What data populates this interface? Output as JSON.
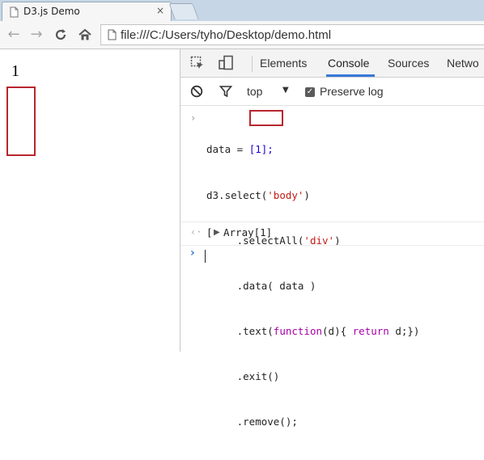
{
  "browser": {
    "tab_title": "D3.js Demo",
    "tab_close": "×",
    "url": "file:///C:/Users/tyho/Desktop/demo.html"
  },
  "page": {
    "text": "1"
  },
  "devtools": {
    "tabs": [
      "Elements",
      "Console",
      "Sources",
      "Netwo"
    ],
    "active_tab": "Console",
    "context": "top",
    "preserve_log_label": "Preserve log",
    "preserve_log_checked": true
  },
  "console": {
    "input_lines": [
      {
        "plain_pre": "data = ",
        "highlight": "[1];"
      },
      {
        "plain": "d3.select(",
        "str": "'body'",
        "plain_post": ")"
      },
      {
        "plain": "     .selectAll(",
        "str": "'div'",
        "plain_post": ")"
      },
      {
        "plain": "     .data( data )"
      },
      {
        "plain": "     .text(",
        "kw": "function",
        "plain_mid": "(d){ ",
        "kw2": "return",
        "plain_post": " d;})"
      },
      {
        "plain": "     .exit()"
      },
      {
        "plain": "     .remove();"
      }
    ],
    "result": "Array[1]",
    "result_prefix": "["
  },
  "colors": {
    "accent_blue": "#3879d9",
    "highlight_red": "#b8262e",
    "string_red": "#c41a16",
    "keyword_purple": "#a800a8"
  }
}
